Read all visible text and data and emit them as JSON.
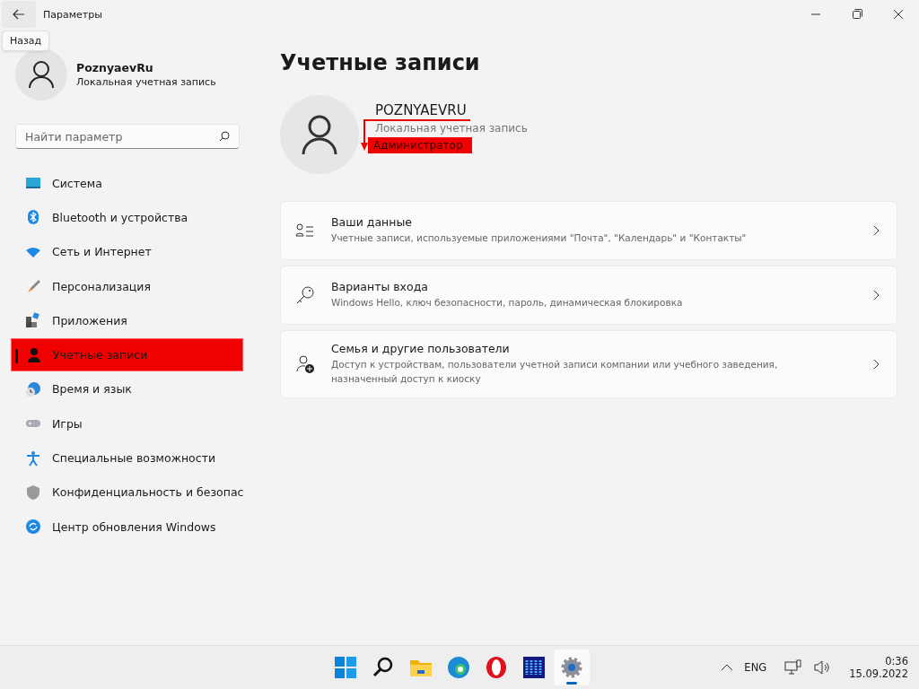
{
  "window": {
    "title": "Параметры",
    "tooltip": "Назад"
  },
  "user": {
    "name": "PoznyaevRu",
    "type": "Локальная учетная запись"
  },
  "search": {
    "placeholder": "Найти параметр"
  },
  "sidebar": {
    "items": [
      {
        "label": "Система",
        "selected": false
      },
      {
        "label": "Bluetooth и устройства",
        "selected": false
      },
      {
        "label": "Сеть и Интернет",
        "selected": false
      },
      {
        "label": "Персонализация",
        "selected": false
      },
      {
        "label": "Приложения",
        "selected": false
      },
      {
        "label": "Учетные записи",
        "selected": true
      },
      {
        "label": "Время и язык",
        "selected": false
      },
      {
        "label": "Игры",
        "selected": false
      },
      {
        "label": "Специальные возможности",
        "selected": false
      },
      {
        "label": "Конфиденциальность и безопас",
        "selected": false
      },
      {
        "label": "Центр обновления Windows",
        "selected": false
      }
    ]
  },
  "page": {
    "title": "Учетные записи",
    "account": {
      "name": "POZNYAEVRU",
      "type": "Локальная учетная запись",
      "role": "Администратор"
    },
    "cards": [
      {
        "title": "Ваши данные",
        "description": "Учетные записи, используемые приложениями \"Почта\", \"Календарь\" и \"Контакты\""
      },
      {
        "title": "Варианты входа",
        "description": "Windows Hello, ключ безопасности, пароль, динамическая блокировка"
      },
      {
        "title": "Семья и другие пользователи",
        "description": "Доступ к устройствам, пользователи учетной записи компании или учебного заведения, назначенный доступ к киоску"
      }
    ]
  },
  "taskbar": {
    "apps": [
      {
        "selected": false
      },
      {
        "selected": false
      },
      {
        "selected": false
      },
      {
        "selected": false
      },
      {
        "selected": false
      },
      {
        "selected": false
      },
      {
        "selected": true
      }
    ],
    "language": "ENG",
    "time": "0:36",
    "date": "15.09.2022"
  }
}
